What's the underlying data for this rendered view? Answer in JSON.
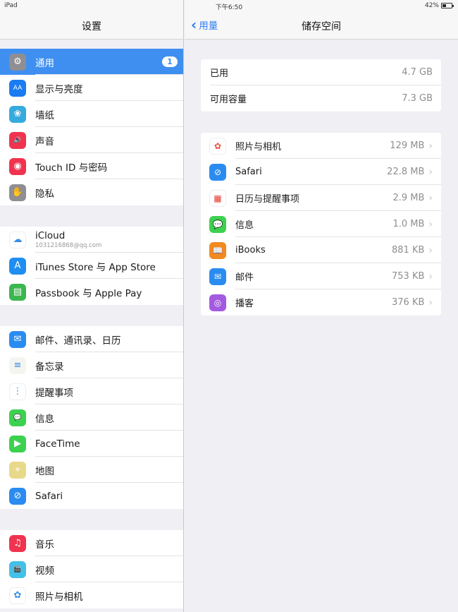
{
  "status_bar": {
    "device": "iPad",
    "time": "下午6:50",
    "battery_percent": "42%",
    "battery_level": 0.42
  },
  "sidebar": {
    "title": "设置",
    "groups": [
      [
        {
          "label": "通用",
          "icon": "gear-icon",
          "color": "#8e8e93",
          "glyph": "⚙",
          "selected": true,
          "badge": "1"
        },
        {
          "label": "显示与亮度",
          "icon": "display-brightness-icon",
          "color": "#1a7cf0",
          "glyph": "AA"
        },
        {
          "label": "墙纸",
          "icon": "wallpaper-flower-icon",
          "color": "#36aadc",
          "glyph": "❀"
        },
        {
          "label": "声音",
          "icon": "speaker-icon",
          "color": "#f0334f",
          "glyph": "🔊"
        },
        {
          "label": "Touch ID 与密码",
          "icon": "fingerprint-icon",
          "color": "#f0334f",
          "glyph": "◉"
        },
        {
          "label": "隐私",
          "icon": "hand-icon",
          "color": "#8e8e93",
          "glyph": "✋"
        }
      ],
      [
        {
          "label": "iCloud",
          "sub": "1031216868@qq.com",
          "icon": "icloud-icon",
          "color": "#ffffff",
          "glyph": "☁"
        },
        {
          "label": "iTunes Store 与 App Store",
          "icon": "app-store-icon",
          "color": "#1f8ef1",
          "glyph": "A"
        },
        {
          "label": "Passbook 与 Apple Pay",
          "icon": "passbook-icon",
          "color": "#3cb64f",
          "glyph": "▤"
        }
      ],
      [
        {
          "label": "邮件、通讯录、日历",
          "icon": "mail-icon",
          "color": "#2a8cf0",
          "glyph": "✉"
        },
        {
          "label": "备忘录",
          "icon": "notes-icon",
          "color": "#f5f5f0",
          "glyph": "≡"
        },
        {
          "label": "提醒事项",
          "icon": "reminders-icon",
          "color": "#ffffff",
          "glyph": "⋮"
        },
        {
          "label": "信息",
          "icon": "messages-icon",
          "color": "#3dd150",
          "glyph": "💬"
        },
        {
          "label": "FaceTime",
          "icon": "facetime-icon",
          "color": "#3dd150",
          "glyph": "▶"
        },
        {
          "label": "地图",
          "icon": "maps-icon",
          "color": "#e8d98a",
          "glyph": "⌖"
        },
        {
          "label": "Safari",
          "icon": "safari-icon",
          "color": "#2a8cf0",
          "glyph": "⊘"
        }
      ],
      [
        {
          "label": "音乐",
          "icon": "music-icon",
          "color": "#f0334f",
          "glyph": "♫"
        },
        {
          "label": "视频",
          "icon": "videos-icon",
          "color": "#43c0e8",
          "glyph": "🎬"
        },
        {
          "label": "照片与相机",
          "icon": "photos-icon",
          "color": "#ffffff",
          "glyph": "✿"
        }
      ]
    ]
  },
  "main": {
    "back_label": "用量",
    "title": "储存空间",
    "summary": [
      {
        "label": "已用",
        "value": "4.7 GB"
      },
      {
        "label": "可用容量",
        "value": "7.3 GB"
      }
    ],
    "apps": [
      {
        "label": "照片与相机",
        "value": "129 MB",
        "icon": "photos-icon",
        "color": "#ffffff",
        "glyph": "✿",
        "fg": "#e8513a"
      },
      {
        "label": "Safari",
        "value": "22.8 MB",
        "icon": "safari-icon",
        "color": "#2a8cf0",
        "glyph": "⊘",
        "fg": "#ffffff"
      },
      {
        "label": "日历与提醒事项",
        "value": "2.9 MB",
        "icon": "calendar-icon",
        "color": "#ffffff",
        "glyph": "▦",
        "fg": "#e8332a"
      },
      {
        "label": "信息",
        "value": "1.0 MB",
        "icon": "messages-icon",
        "color": "#3dd150",
        "glyph": "💬",
        "fg": "#ffffff"
      },
      {
        "label": "iBooks",
        "value": "881 KB",
        "icon": "ibooks-icon",
        "color": "#f18a1f",
        "glyph": "📖",
        "fg": "#ffffff"
      },
      {
        "label": "邮件",
        "value": "753 KB",
        "icon": "mail-icon",
        "color": "#2a8cf0",
        "glyph": "✉",
        "fg": "#ffffff"
      },
      {
        "label": "播客",
        "value": "376 KB",
        "icon": "podcasts-icon",
        "color": "#a45ae0",
        "glyph": "◎",
        "fg": "#ffffff"
      }
    ]
  }
}
